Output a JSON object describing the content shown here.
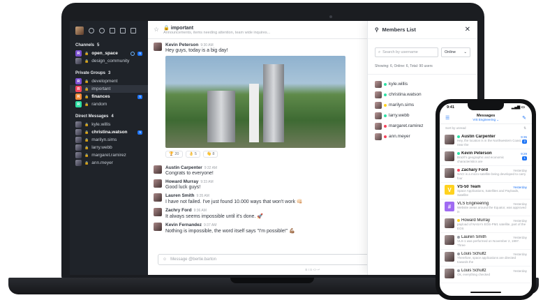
{
  "sidebar": {
    "channels_label": "Channels",
    "channels_count": "5",
    "channels": [
      {
        "letter": "R",
        "color": "#7b4fd1",
        "label": "open_space",
        "bold": true,
        "unread": "5"
      },
      {
        "letter": "",
        "color": "",
        "label": "design_community",
        "bold": false,
        "unread": ""
      }
    ],
    "groups_label": "Private Groups",
    "groups_count": "3",
    "groups": [
      {
        "letter": "R",
        "color": "#7b4fd1",
        "label": "development",
        "bold": false,
        "unread": ""
      },
      {
        "letter": "R",
        "color": "#f5455c",
        "label": "important",
        "bold": false,
        "unread": "",
        "active": true
      },
      {
        "letter": "R",
        "color": "#f38c39",
        "label": "finances",
        "bold": true,
        "unread": "5"
      },
      {
        "letter": "R",
        "color": "#2de0a5",
        "label": "random",
        "bold": false,
        "unread": ""
      }
    ],
    "dm_label": "Direct Messages",
    "dm_count": "4",
    "dms": [
      {
        "label": "kyle.willis",
        "bold": false,
        "unread": ""
      },
      {
        "label": "christina.watson",
        "bold": true,
        "unread": "5"
      },
      {
        "label": "marilyn.sims",
        "bold": false,
        "unread": ""
      },
      {
        "label": "larry.webb",
        "bold": false,
        "unread": ""
      },
      {
        "label": "margaret.ramirez",
        "bold": false,
        "unread": ""
      },
      {
        "label": "ann.meyer",
        "bold": false,
        "unread": ""
      }
    ]
  },
  "header": {
    "title": "important",
    "topic": "Announcements, items needing attention, team wide inquires..."
  },
  "messages": {
    "first": {
      "user": "Kevin Peterson",
      "time": "9:30 AM",
      "text": "Hey guys, today is a big day!"
    },
    "reactions": [
      "🏆 20",
      "👌 5",
      "👋 8"
    ],
    "list": [
      {
        "user": "Austin Carpenter",
        "time": "9:32 AM",
        "text": "Congrats to everyone!"
      },
      {
        "user": "Howard Murray",
        "time": "9:33 AM",
        "text": "Good luck guys!"
      },
      {
        "user": "Lauren Smith",
        "time": "9:35 AM",
        "text": "I have not failed. I've just found 10.000 ways that won't work 👊🏻"
      },
      {
        "user": "Zachry Ford",
        "time": "9:36 AM",
        "text": "It always seems impossible until it's done. 🚀"
      },
      {
        "user": "Kevin Fernandez",
        "time": "9:37 AM",
        "text": "Nothing is impossible, the word itself says \"I'm possible!\" 💪🏽"
      }
    ]
  },
  "composer": {
    "placeholder": "Message @bertie.barton",
    "format_bar": "B  I  S  <>  ↵"
  },
  "members": {
    "title": "Members List",
    "search_placeholder": "Search by username",
    "filter": "Online",
    "showing": "Showing: 6, Online: 6, Total: 90 users",
    "users": [
      {
        "name": "kyle.willis",
        "status": "#2de0a5"
      },
      {
        "name": "christina.watson",
        "status": "#2de0a5"
      },
      {
        "name": "marilyn.sims",
        "status": "#ffd21f"
      },
      {
        "name": "larry.webb",
        "status": "#2de0a5"
      },
      {
        "name": "margaret.ramirez",
        "status": "#f5455c"
      },
      {
        "name": "ann.meyer",
        "status": "#f5455c"
      }
    ]
  },
  "phone": {
    "time": "9:41",
    "title": "Messages",
    "workspace": "VIS Engineering ⌄",
    "sort": "Sort by unread",
    "rows": [
      {
        "name": "Austin Carpenter",
        "time": "9:35",
        "preview": "Hey, the location is in the Northwestern Coast, near the",
        "bold": true,
        "badge": "2",
        "dot": "#2de0a5",
        "letter": "",
        "color": ""
      },
      {
        "name": "Kevin Peterson",
        "time": "9:29",
        "preview": "Brazil's geographic and economic characteristics are",
        "bold": true,
        "badge": "1",
        "dot": "#2de0a5",
        "letter": "",
        "color": ""
      },
      {
        "name": "Zachary Ford",
        "time": "Yesterday",
        "preview": "SACI is a micro-satellite being developed to carry four",
        "bold": true,
        "badge": "",
        "dot": "#f5455c",
        "letter": "",
        "color": ""
      },
      {
        "name": "VS-50 Team",
        "time": "Yesterday",
        "preview": "Space Applications, Satellites and Payloads, Satellite",
        "bold": true,
        "badge": "",
        "dot": "",
        "letter": "V",
        "color": "#ffd21f"
      },
      {
        "name": "VLS Engineering",
        "time": "Yesterday",
        "preview": "Website areas around the Equator, was approved in",
        "bold": false,
        "badge": "",
        "dot": "",
        "letter": "#",
        "color": "#a06bf2"
      },
      {
        "name": "Howard Murray",
        "time": "Yesterday",
        "preview": "payload of NASA's EOS-PM1 satellite, part of the EOS",
        "bold": false,
        "badge": "",
        "dot": "#ffd21f",
        "letter": "",
        "color": ""
      },
      {
        "name": "Lauren Smith",
        "time": "Yesterday",
        "preview": "VLS-1 was performed on November 2, 1997. Three",
        "bold": false,
        "badge": "",
        "dot": "#9ea2a8",
        "letter": "",
        "color": ""
      },
      {
        "name": "Louis Schultz",
        "time": "Yesterday",
        "preview": "Therefore, space applications are directed towards the",
        "bold": false,
        "badge": "",
        "dot": "#9ea2a8",
        "letter": "",
        "color": ""
      },
      {
        "name": "Louis Schultz",
        "time": "Yesterday",
        "preview": "Ok, everything checked",
        "bold": false,
        "badge": "",
        "dot": "#9ea2a8",
        "letter": "",
        "color": ""
      }
    ]
  }
}
